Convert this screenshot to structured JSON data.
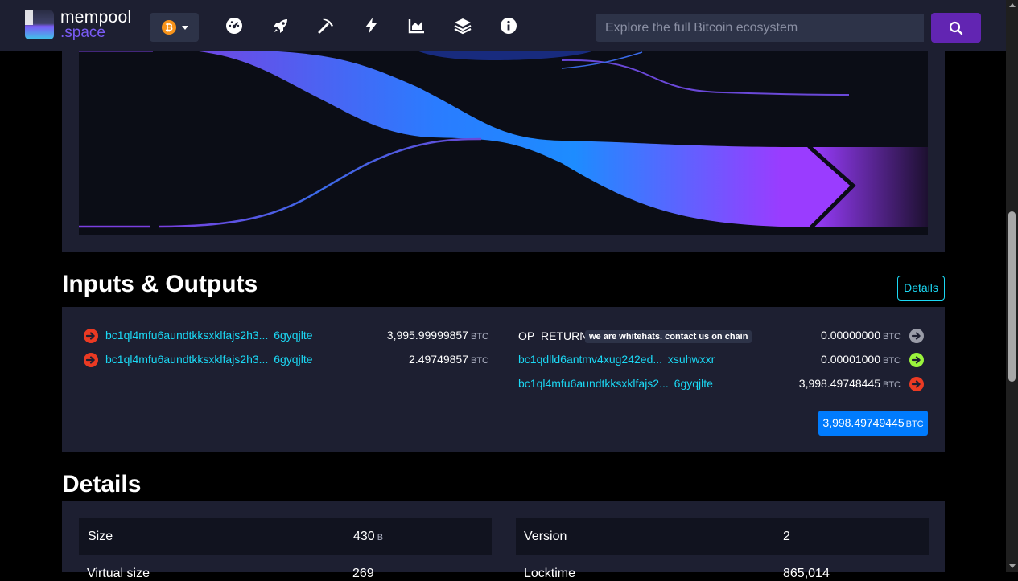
{
  "header": {
    "logo_name": "mempool",
    "logo_suffix": ".space",
    "network_symbol": "₿",
    "search_placeholder": "Explore the full Bitcoin ecosystem",
    "nav_icons": [
      "dashboard-icon",
      "rocket-icon",
      "mining-icon",
      "lightning-icon",
      "graphs-icon",
      "blocks-icon",
      "info-icon"
    ]
  },
  "colors": {
    "accent_purple": "#6225b2",
    "link_cyan": "#1bd8f4",
    "badge_blue": "#007bfd",
    "spent_red": "#eb3a23",
    "unspent_green": "#9af43c",
    "panel": "#1d1f31"
  },
  "io": {
    "title": "Inputs & Outputs",
    "details_button": "Details",
    "inputs": [
      {
        "address_start": "bc1ql4mfu6aundtkksxklfajs2h3...",
        "address_end": "6gyqjlte",
        "amount": "3,995.99999857",
        "unit": "BTC"
      },
      {
        "address_start": "bc1ql4mfu6aundtkksxklfajs2h3...",
        "address_end": "6gyqjlte",
        "amount": "2.49749857",
        "unit": "BTC"
      }
    ],
    "outputs": [
      {
        "label": "OP_RETURN",
        "message": "we are whitehats. contact us on chain",
        "amount": "0.00000000",
        "unit": "BTC",
        "status": "op_return"
      },
      {
        "address_start": "bc1qdlld6antmv4xug242ed...",
        "address_end": "xsuhwxxr",
        "amount": "0.00001000",
        "unit": "BTC",
        "status": "unspent"
      },
      {
        "address_start": "bc1ql4mfu6aundtkksxklfajs2...",
        "address_end": "6gyqjlte",
        "amount": "3,998.49748445",
        "unit": "BTC",
        "status": "spent"
      }
    ],
    "total_amount": "3,998.49749445",
    "total_unit": "BTC"
  },
  "details": {
    "title": "Details",
    "rows": [
      {
        "label": "Size",
        "value": "430",
        "unit": "B"
      },
      {
        "label": "Version",
        "value": "2",
        "unit": ""
      }
    ],
    "partial_left_label": "Virtual size",
    "partial_left_value": "269",
    "partial_right_label": "Locktime",
    "partial_right_value": "865,014"
  }
}
